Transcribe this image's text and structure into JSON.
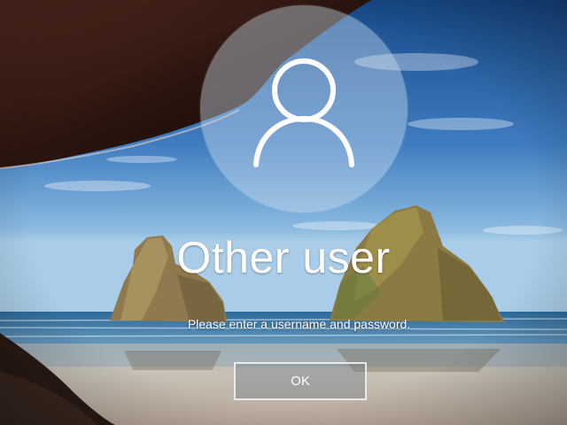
{
  "login": {
    "title": "Other user",
    "message": "Please enter a username and password.",
    "ok_button_label": "OK",
    "avatar_icon": "user-icon"
  },
  "colors": {
    "sky_top": "#1a4f8f",
    "sky_horizon": "#7fb2dc",
    "sea": "#3f7aa6",
    "sand": "#c9bfb2",
    "cave_dark": "#2a1510",
    "rock": "#8a7a4c"
  }
}
